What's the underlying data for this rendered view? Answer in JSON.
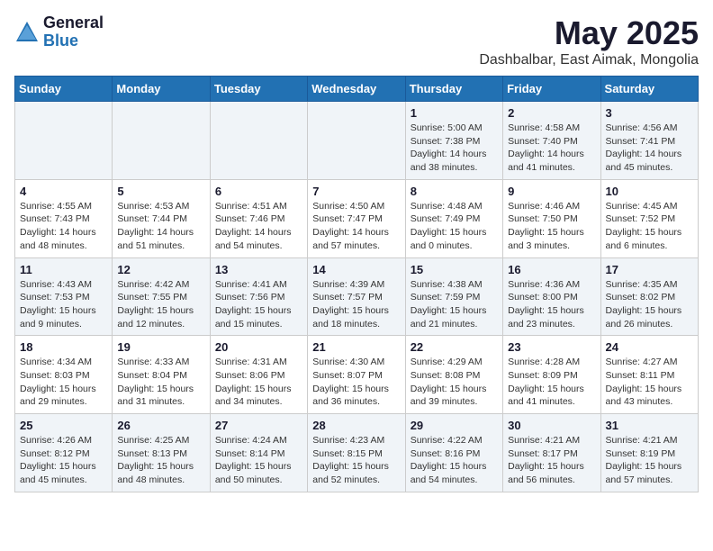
{
  "header": {
    "logo": {
      "general": "General",
      "blue": "Blue"
    },
    "title": "May 2025",
    "location": "Dashbalbar, East Aimak, Mongolia"
  },
  "weekdays": [
    "Sunday",
    "Monday",
    "Tuesday",
    "Wednesday",
    "Thursday",
    "Friday",
    "Saturday"
  ],
  "weeks": [
    [
      {
        "day": "",
        "sunrise": "",
        "sunset": "",
        "daylight": ""
      },
      {
        "day": "",
        "sunrise": "",
        "sunset": "",
        "daylight": ""
      },
      {
        "day": "",
        "sunrise": "",
        "sunset": "",
        "daylight": ""
      },
      {
        "day": "",
        "sunrise": "",
        "sunset": "",
        "daylight": ""
      },
      {
        "day": "1",
        "sunrise": "Sunrise: 5:00 AM",
        "sunset": "Sunset: 7:38 PM",
        "daylight": "Daylight: 14 hours and 38 minutes."
      },
      {
        "day": "2",
        "sunrise": "Sunrise: 4:58 AM",
        "sunset": "Sunset: 7:40 PM",
        "daylight": "Daylight: 14 hours and 41 minutes."
      },
      {
        "day": "3",
        "sunrise": "Sunrise: 4:56 AM",
        "sunset": "Sunset: 7:41 PM",
        "daylight": "Daylight: 14 hours and 45 minutes."
      }
    ],
    [
      {
        "day": "4",
        "sunrise": "Sunrise: 4:55 AM",
        "sunset": "Sunset: 7:43 PM",
        "daylight": "Daylight: 14 hours and 48 minutes."
      },
      {
        "day": "5",
        "sunrise": "Sunrise: 4:53 AM",
        "sunset": "Sunset: 7:44 PM",
        "daylight": "Daylight: 14 hours and 51 minutes."
      },
      {
        "day": "6",
        "sunrise": "Sunrise: 4:51 AM",
        "sunset": "Sunset: 7:46 PM",
        "daylight": "Daylight: 14 hours and 54 minutes."
      },
      {
        "day": "7",
        "sunrise": "Sunrise: 4:50 AM",
        "sunset": "Sunset: 7:47 PM",
        "daylight": "Daylight: 14 hours and 57 minutes."
      },
      {
        "day": "8",
        "sunrise": "Sunrise: 4:48 AM",
        "sunset": "Sunset: 7:49 PM",
        "daylight": "Daylight: 15 hours and 0 minutes."
      },
      {
        "day": "9",
        "sunrise": "Sunrise: 4:46 AM",
        "sunset": "Sunset: 7:50 PM",
        "daylight": "Daylight: 15 hours and 3 minutes."
      },
      {
        "day": "10",
        "sunrise": "Sunrise: 4:45 AM",
        "sunset": "Sunset: 7:52 PM",
        "daylight": "Daylight: 15 hours and 6 minutes."
      }
    ],
    [
      {
        "day": "11",
        "sunrise": "Sunrise: 4:43 AM",
        "sunset": "Sunset: 7:53 PM",
        "daylight": "Daylight: 15 hours and 9 minutes."
      },
      {
        "day": "12",
        "sunrise": "Sunrise: 4:42 AM",
        "sunset": "Sunset: 7:55 PM",
        "daylight": "Daylight: 15 hours and 12 minutes."
      },
      {
        "day": "13",
        "sunrise": "Sunrise: 4:41 AM",
        "sunset": "Sunset: 7:56 PM",
        "daylight": "Daylight: 15 hours and 15 minutes."
      },
      {
        "day": "14",
        "sunrise": "Sunrise: 4:39 AM",
        "sunset": "Sunset: 7:57 PM",
        "daylight": "Daylight: 15 hours and 18 minutes."
      },
      {
        "day": "15",
        "sunrise": "Sunrise: 4:38 AM",
        "sunset": "Sunset: 7:59 PM",
        "daylight": "Daylight: 15 hours and 21 minutes."
      },
      {
        "day": "16",
        "sunrise": "Sunrise: 4:36 AM",
        "sunset": "Sunset: 8:00 PM",
        "daylight": "Daylight: 15 hours and 23 minutes."
      },
      {
        "day": "17",
        "sunrise": "Sunrise: 4:35 AM",
        "sunset": "Sunset: 8:02 PM",
        "daylight": "Daylight: 15 hours and 26 minutes."
      }
    ],
    [
      {
        "day": "18",
        "sunrise": "Sunrise: 4:34 AM",
        "sunset": "Sunset: 8:03 PM",
        "daylight": "Daylight: 15 hours and 29 minutes."
      },
      {
        "day": "19",
        "sunrise": "Sunrise: 4:33 AM",
        "sunset": "Sunset: 8:04 PM",
        "daylight": "Daylight: 15 hours and 31 minutes."
      },
      {
        "day": "20",
        "sunrise": "Sunrise: 4:31 AM",
        "sunset": "Sunset: 8:06 PM",
        "daylight": "Daylight: 15 hours and 34 minutes."
      },
      {
        "day": "21",
        "sunrise": "Sunrise: 4:30 AM",
        "sunset": "Sunset: 8:07 PM",
        "daylight": "Daylight: 15 hours and 36 minutes."
      },
      {
        "day": "22",
        "sunrise": "Sunrise: 4:29 AM",
        "sunset": "Sunset: 8:08 PM",
        "daylight": "Daylight: 15 hours and 39 minutes."
      },
      {
        "day": "23",
        "sunrise": "Sunrise: 4:28 AM",
        "sunset": "Sunset: 8:09 PM",
        "daylight": "Daylight: 15 hours and 41 minutes."
      },
      {
        "day": "24",
        "sunrise": "Sunrise: 4:27 AM",
        "sunset": "Sunset: 8:11 PM",
        "daylight": "Daylight: 15 hours and 43 minutes."
      }
    ],
    [
      {
        "day": "25",
        "sunrise": "Sunrise: 4:26 AM",
        "sunset": "Sunset: 8:12 PM",
        "daylight": "Daylight: 15 hours and 45 minutes."
      },
      {
        "day": "26",
        "sunrise": "Sunrise: 4:25 AM",
        "sunset": "Sunset: 8:13 PM",
        "daylight": "Daylight: 15 hours and 48 minutes."
      },
      {
        "day": "27",
        "sunrise": "Sunrise: 4:24 AM",
        "sunset": "Sunset: 8:14 PM",
        "daylight": "Daylight: 15 hours and 50 minutes."
      },
      {
        "day": "28",
        "sunrise": "Sunrise: 4:23 AM",
        "sunset": "Sunset: 8:15 PM",
        "daylight": "Daylight: 15 hours and 52 minutes."
      },
      {
        "day": "29",
        "sunrise": "Sunrise: 4:22 AM",
        "sunset": "Sunset: 8:16 PM",
        "daylight": "Daylight: 15 hours and 54 minutes."
      },
      {
        "day": "30",
        "sunrise": "Sunrise: 4:21 AM",
        "sunset": "Sunset: 8:17 PM",
        "daylight": "Daylight: 15 hours and 56 minutes."
      },
      {
        "day": "31",
        "sunrise": "Sunrise: 4:21 AM",
        "sunset": "Sunset: 8:19 PM",
        "daylight": "Daylight: 15 hours and 57 minutes."
      }
    ]
  ]
}
